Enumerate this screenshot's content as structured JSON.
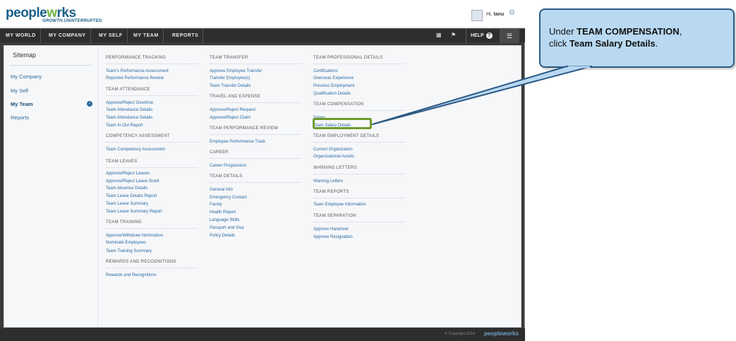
{
  "app": {
    "logo_prefix": "pe",
    "logo_mid": "ople",
    "logo_w": "w",
    "logo_suffix": "rks",
    "tagline": "GROWTH.UNINTERRUPTED.",
    "greeting": "Hi,",
    "user_name": "tanu"
  },
  "nav": {
    "items": [
      "MY WORLD",
      "MY COMPANY",
      "MY SELF",
      "MY TEAM",
      "REPORTS"
    ],
    "help_label": "HELP"
  },
  "sidebar": {
    "title": "Sitemap",
    "items": [
      "My Company",
      "My Self",
      "My Team",
      "Reports"
    ],
    "active_item": "My Team"
  },
  "columns": {
    "col1": {
      "sections": [
        {
          "title": "PERFORMANCE TRACKING",
          "links": [
            "Team's Performance Assessment",
            "Reportee Performance Review"
          ]
        },
        {
          "title": "TEAM ATTENDANCE",
          "links": [
            "Approve/Reject Overtime",
            "Team Attendance Details",
            "Team Attendance Details",
            "Team In-Out Report"
          ]
        },
        {
          "title": "COMPETENCY ASSESSMENT",
          "links": [
            "Team Competency Assessment"
          ]
        },
        {
          "title": "TEAM LEAVES",
          "links": [
            "Approve/Reject Leaves",
            "Approve/Reject Leave Grant",
            "Team Absence Details",
            "Team Leave Details Report",
            "Team Leave Summary",
            "Team Leave Summary Report"
          ]
        },
        {
          "title": "TEAM TRAINING",
          "links": [
            "Approve/Withdraw Nomination",
            "Nominate Employees",
            "Team Training Summary"
          ]
        },
        {
          "title": "REWARDS AND RECOGNITIONS",
          "links": [
            "Rewards and Recognitions"
          ]
        }
      ]
    },
    "col2": {
      "sections": [
        {
          "title": "TEAM TRANSFER",
          "links": [
            "Approve Employee Transfer",
            "Transfer Employee(s)",
            "Team Transfer Details"
          ]
        },
        {
          "title": "TRAVEL AND EXPENSE",
          "links": [
            "Approve/Reject Request",
            "Approve/Reject Claim"
          ]
        },
        {
          "title": "TEAM PERFORMANCE REVIEW",
          "links": [
            "Employee Performance Track"
          ]
        },
        {
          "title": "CAREER",
          "links": [
            "Career Progression"
          ]
        },
        {
          "title": "TEAM DETAILS",
          "links": [
            "General Info",
            "Emergency Contact",
            "Family",
            "Health Report",
            "Language Skills",
            "Passport and Visa",
            "Policy Details"
          ]
        }
      ]
    },
    "col3": {
      "sections": [
        {
          "title": "TEAM PROFESSIONAL DETAILS",
          "links": [
            "Certifications",
            "Overseas Experience",
            "Previous Employment",
            "Qualification Details"
          ]
        },
        {
          "title": "TEAM COMPENSATION",
          "links": [
            "Salary",
            "Team Salary Details"
          ]
        },
        {
          "title": "TEAM EMPLOYMENT DETAILS",
          "links": [
            "Current Organization",
            "Organizational Assets"
          ]
        },
        {
          "title": "WARNING LETTERS",
          "links": [
            "Warning Letters"
          ]
        },
        {
          "title": "TEAM REPORTS",
          "links": [
            "Team Employee Information"
          ]
        },
        {
          "title": "TEAM SEPARATION",
          "links": [
            "Approve Handover",
            "Approve Resignation"
          ]
        }
      ]
    }
  },
  "footer": {
    "copyright": "© Copyright 2014",
    "logo": "peopleworks"
  },
  "callout": {
    "line1_prefix": "Under ",
    "line1_bold": "TEAM COMPENSATION",
    "line1_suffix": ",",
    "line2_prefix": "click ",
    "line2_bold": "Team Salary Details",
    "line2_suffix": "."
  },
  "colors": {
    "link": "#2a6aa0",
    "highlight": "#6f9a2a",
    "callout_bg": "#b9d9f2",
    "callout_border": "#2c5a84",
    "navbar": "#2e2e2e"
  },
  "icons": [
    "settings-gear-icon",
    "grid-icon",
    "pin-icon",
    "help-icon",
    "menu-icon",
    "chevron-right-icon"
  ]
}
